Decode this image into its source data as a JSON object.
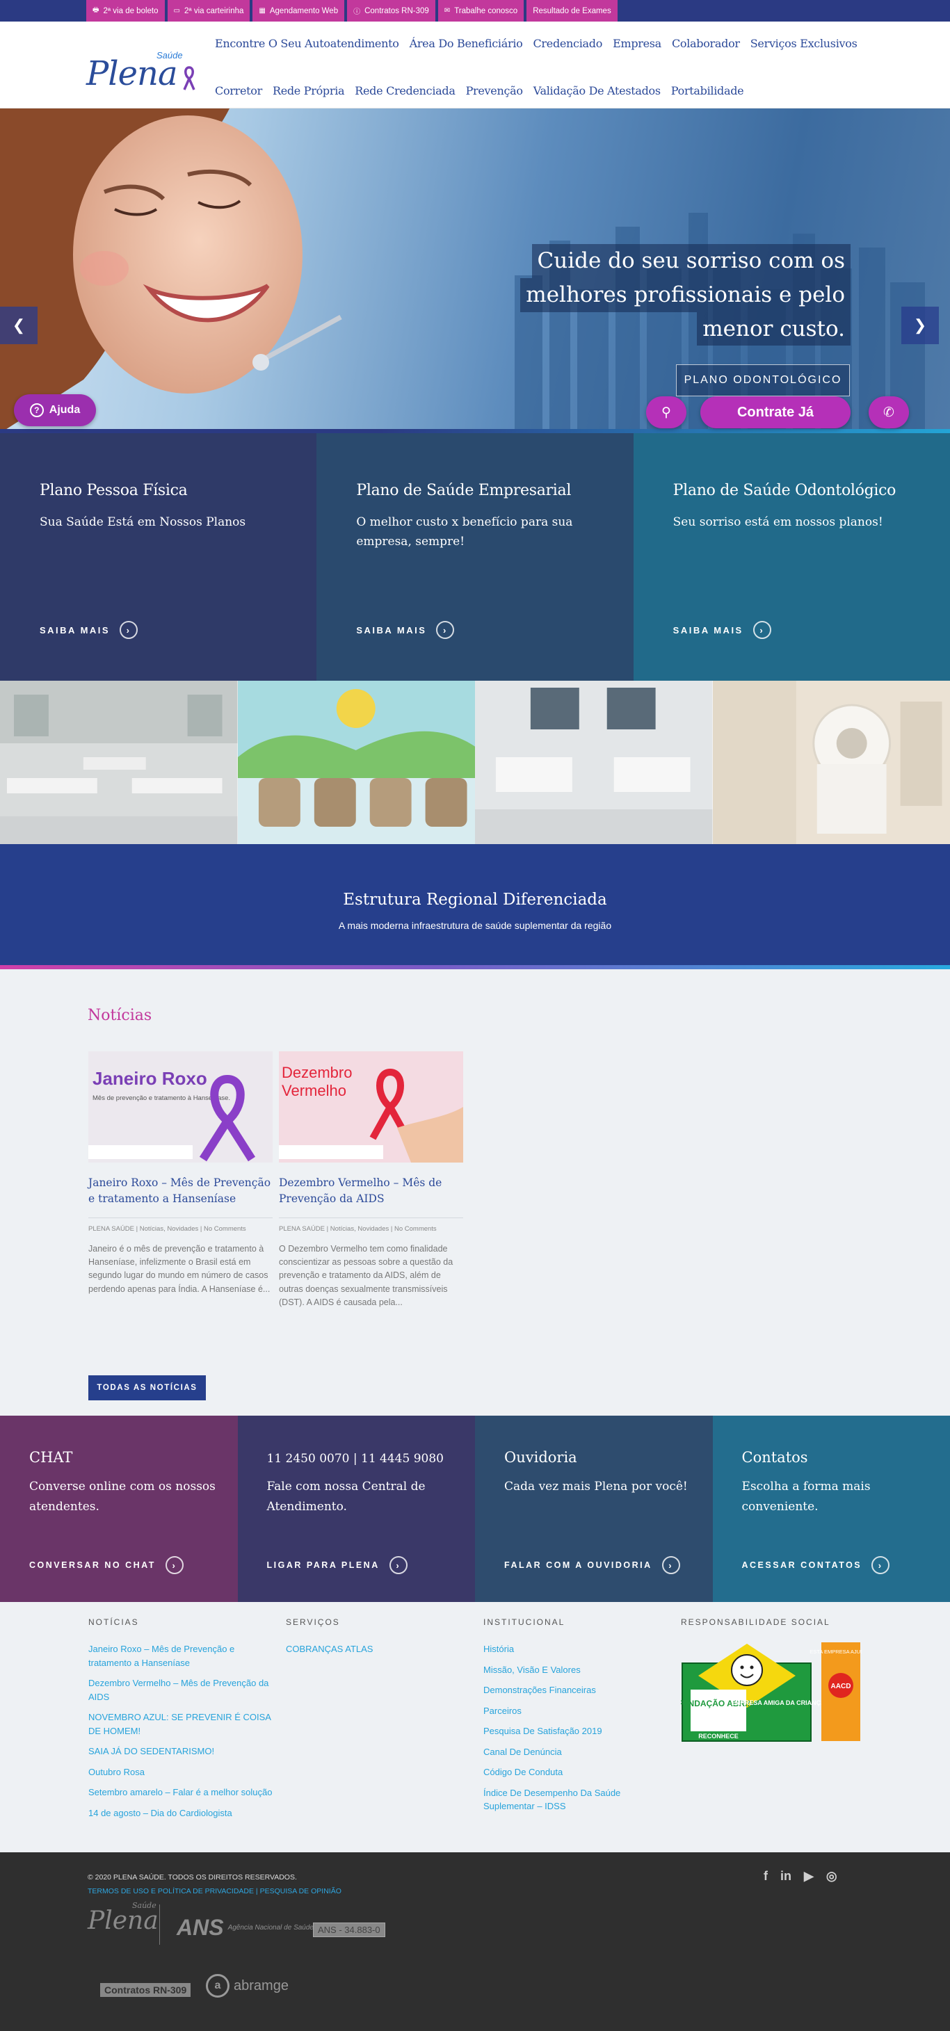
{
  "topbar": {
    "links": [
      {
        "icon": "printer-icon",
        "glyph": "🖶",
        "label": "2ª via de boleto"
      },
      {
        "icon": "card-icon",
        "glyph": "▭",
        "label": "2ª via carteirinha"
      },
      {
        "icon": "calendar-icon",
        "glyph": "▦",
        "label": "Agendamento Web"
      },
      {
        "icon": "info-icon",
        "glyph": "ⓘ",
        "label": "Contratos RN-309"
      },
      {
        "icon": "mail-icon",
        "glyph": "✉",
        "label": "Trabalhe conosco"
      },
      {
        "icon": "",
        "glyph": "",
        "label": "Resultado de Exames"
      }
    ]
  },
  "logo": {
    "name": "Plena",
    "tag": "Saúde"
  },
  "nav": {
    "row1": [
      "Encontre O Seu Autoatendimento",
      "Área Do Beneficiário",
      "Credenciado",
      "Empresa",
      "Colaborador",
      "Serviços Exclusivos"
    ],
    "row2": [
      "Corretor",
      "Rede Própria",
      "Rede Credenciada",
      "Prevenção",
      "Validação De Atestados",
      "Portabilidade"
    ]
  },
  "hero": {
    "caption_lines": [
      "Cuide do seu sorriso com os",
      "melhores profissionais e pelo",
      "menor custo."
    ],
    "cta": "PLANO ODONTOLÓGICO"
  },
  "floating": {
    "help": "Ajuda",
    "contrate": "Contrate Já"
  },
  "plans": [
    {
      "title": "Plano Pessoa Física",
      "subtitle": "Sua Saúde Está em Nossos Planos",
      "more": "SAIBA MAIS",
      "color": "#2f3a68"
    },
    {
      "title": "Plano de Saúde Empresarial",
      "subtitle": "O melhor custo x benefício para sua empresa, sempre!",
      "more": "SAIBA MAIS",
      "color": "#2a4a6e"
    },
    {
      "title": "Plano de Saúde Odontológico",
      "subtitle": "Seu sorriso está em nossos planos!",
      "more": "SAIBA MAIS",
      "color": "#216a8a"
    }
  ],
  "estrutura": {
    "title": "Estrutura Regional Diferenciada",
    "subtitle": "A mais moderna infraestrutura de saúde suplementar da região"
  },
  "news": {
    "heading": "Notícias",
    "items": [
      {
        "img_title": "Janeiro Roxo",
        "img_sub": "Mês de prevenção e tratamento à Hanseníase.",
        "title": "Janeiro Roxo – Mês de Prevenção e tratamento a Hanseníase",
        "meta": "PLENA SAÚDE | Notícias, Novidades | No Comments",
        "excerpt": "Janeiro é o mês de prevenção e tratamento à Hanseníase, infelizmente o Brasil está em segundo lugar do mundo em número de casos perdendo apenas para Índia. A Hanseníase é..."
      },
      {
        "img_title": "Dezembro Vermelho",
        "img_sub": "",
        "title": "Dezembro Vermelho – Mês de Prevenção da AIDS",
        "meta": "PLENA SAÚDE | Notícias, Novidades | No Comments",
        "excerpt": "O Dezembro Vermelho tem como finalidade conscientizar as pessoas sobre a questão da prevenção e tratamento da AIDS, além de outras doenças sexualmente transmissíveis (DST). A AIDS é causada pela..."
      }
    ],
    "all_button": "TODAS AS NOTÍCIAS"
  },
  "contacts": [
    {
      "title": "CHAT",
      "text": "Converse online com os nossos atendentes.",
      "more": "CONVERSAR NO CHAT",
      "color": "#6a3568"
    },
    {
      "title": "11 2450 0070 | 11 4445 9080",
      "text": "Fale com nossa Central de Atendimento.",
      "more": "LIGAR PARA PLENA",
      "color": "#3a3868"
    },
    {
      "title": "Ouvidoria",
      "text": "Cada vez mais Plena por você!",
      "more": "FALAR COM A OUVIDORIA",
      "color": "#2e4c6e"
    },
    {
      "title": "Contatos",
      "text": "Escolha a forma mais conveniente.",
      "more": "ACESSAR CONTATOS",
      "color": "#236d8e"
    }
  ],
  "footer_cols": {
    "noticias": {
      "heading": "NOTÍCIAS",
      "items": [
        "Janeiro Roxo – Mês de Prevenção e tratamento a Hanseníase",
        "Dezembro Vermelho – Mês de Prevenção da AIDS",
        "NOVEMBRO AZUL: SE PREVENIR É COISA DE HOMEM!",
        "SAIA JÁ DO SEDENTARISMO!",
        "Outubro Rosa",
        "Setembro amarelo – Falar é a melhor solução",
        "14 de agosto – Dia do Cardiologista"
      ]
    },
    "servicos": {
      "heading": "SERVIÇOS",
      "items": [
        "COBRANÇAS ATLAS"
      ]
    },
    "institucional": {
      "heading": "INSTITUCIONAL",
      "items": [
        "História",
        "Missão, Visão E Valores",
        "Demonstrações Financeiras",
        "Parceiros",
        "Pesquisa De Satisfação 2019",
        "Canal De Denúncia",
        "Código De Conduta",
        "Índice De Desempenho Da Saúde Suplementar – IDSS"
      ]
    },
    "social": {
      "heading": "RESPONSABILIDADE SOCIAL",
      "abrinq_left": "FUNDAÇÃO ABRINQ",
      "abrinq_right": "EMPRESA AMIGA DA CRIANÇA",
      "abrinq_bottom": "RECONHECE",
      "aacd_top": "ESTA EMPRESA AJUDA A",
      "aacd_logo": "AACD"
    }
  },
  "bottom": {
    "copyright": "© 2020 PLENA SAÚDE. TODOS OS DIREITOS RESERVADOS.",
    "terms": "TERMOS DE USO E POLÍTICA DE PRIVACIDADE | PESQUISA DE OPINIÃO",
    "ans_name": "ANS",
    "ans_sub": "Agência Nacional de Saúde Suplementar",
    "ans_number": "ANS - 34.883-0",
    "rn": "Contratos RN-309",
    "abramge": "abramge",
    "social": [
      "f",
      "in",
      "▶",
      "◎"
    ]
  }
}
